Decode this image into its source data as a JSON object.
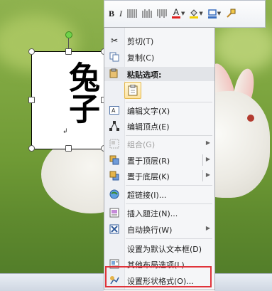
{
  "shape_text": "兔子",
  "mini_toolbar": {
    "buttons": [
      {
        "name": "bold-button",
        "glyph": "B"
      },
      {
        "name": "italic-button",
        "glyph": "I"
      },
      {
        "name": "align-button-1",
        "glyph": "▥"
      },
      {
        "name": "align-button-2",
        "glyph": "▤"
      },
      {
        "name": "align-button-3",
        "glyph": "▦"
      },
      {
        "name": "font-color-button",
        "glyph": "A"
      },
      {
        "name": "fill-color-button",
        "glyph": "◈"
      },
      {
        "name": "outline-button",
        "glyph": "▭"
      },
      {
        "name": "format-painter-button",
        "glyph": "✎"
      }
    ],
    "font_color": "#e02020",
    "fill_color": "#f4d000"
  },
  "menu": {
    "cut": "剪切(T)",
    "copy": "复制(C)",
    "paste_options": "粘贴选项:",
    "edit_text": "编辑文字(X)",
    "edit_points": "编辑顶点(E)",
    "group": "组合(G)",
    "bring_to_front": "置于顶层(R)",
    "send_to_back": "置于底层(K)",
    "hyperlink": "超链接(I)...",
    "insert_caption": "插入题注(N)...",
    "wrap_text": "自动换行(W)",
    "set_default_textbox": "设置为默认文本框(D)",
    "more_layout": "其他布局选项(L)...",
    "format_shape": "设置形状格式(O)..."
  }
}
